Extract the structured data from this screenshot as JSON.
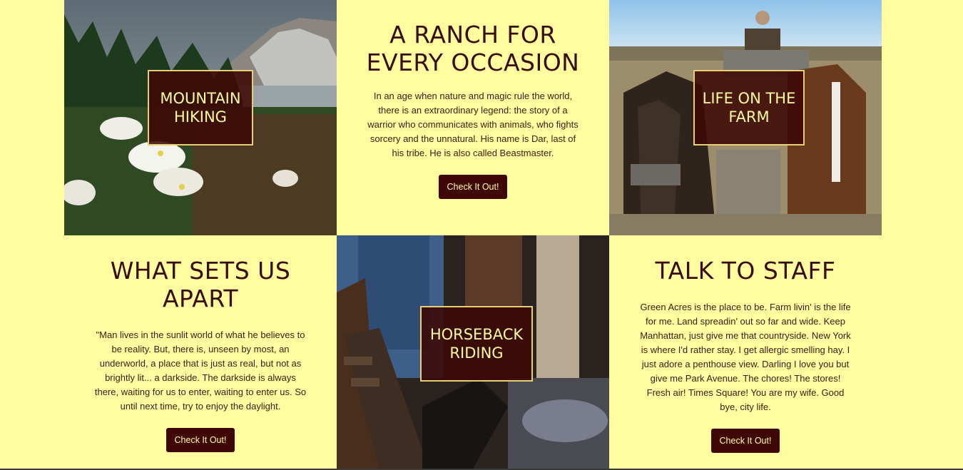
{
  "cards": {
    "mountain": {
      "label_line1": "MOUNTAIN",
      "label_line2": "HIKING"
    },
    "ranch": {
      "title_line1": "A RANCH FOR",
      "title_line2": "EVERY OCCASION",
      "body": "In an age when nature and magic rule the world, there is an extraordinary legend: the story of a warrior who communicates with animals, who fights sorcery and the unnatural. His name is Dar, last of his tribe. He is also called Beastmaster.",
      "button": "Check It Out!"
    },
    "farm": {
      "label_line1": "LIFE ON THE",
      "label_line2": "FARM"
    },
    "apart": {
      "title_line1": "WHAT SETS US",
      "title_line2": "APART",
      "body": "\"Man lives in the sunlit world of what he believes to be reality. But, there is, unseen by most, an underworld, a place that is just as real, but not as brightly lit... a darkside. The darkside is always there, waiting for us to enter, waiting to enter us. So until next time, try to enjoy the daylight.",
      "button": "Check It Out!"
    },
    "horseback": {
      "label_line1": "HORSEBACK",
      "label_line2": "RIDING"
    },
    "staff": {
      "title_line1": "TALK TO STAFF",
      "body": "Green Acres is the place to be. Farm livin' is the life for me. Land spreadin' out so far and wide. Keep Manhattan, just give me that countryside. New York is where I'd rather stay. I get allergic smelling hay. I just adore a penthouse view. Darling I love you but give me Park Avenue. The chores! The stores! Fresh air! Times Square! You are my wife. Good bye, city life.",
      "button": "Check It Out!"
    }
  },
  "colors": {
    "page_bg": "#fffd9f",
    "brand_dark": "#3f0705",
    "overlay_border": "#e6cf75"
  }
}
